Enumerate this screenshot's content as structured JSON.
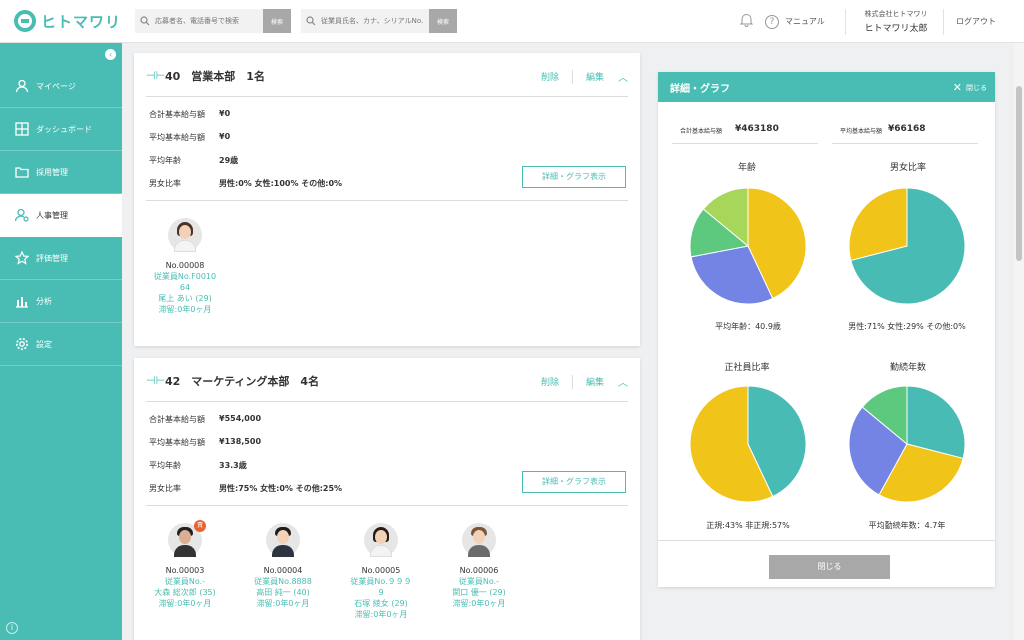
{
  "brand": {
    "name": "ヒトマワリ"
  },
  "header": {
    "search1": {
      "placeholder": "応募者名、電話番号で検索",
      "button": "検索"
    },
    "search2": {
      "placeholder": "従業員氏名、カナ、シリアルNo.",
      "button": "検索"
    },
    "manual_label": "マニュアル",
    "company": "株式会社ヒトマワリ",
    "user": "ヒトマワリ太郎",
    "logout_label": "ログアウト"
  },
  "sidebar": {
    "collapse_icon": "chevron-left-icon",
    "items": [
      {
        "label": "マイページ",
        "icon": "user-icon"
      },
      {
        "label": "ダッシュボード",
        "icon": "dashboard-icon"
      },
      {
        "label": "採用管理",
        "icon": "folder-icon"
      },
      {
        "label": "人事管理",
        "icon": "person-settings-icon",
        "active": true
      },
      {
        "label": "評価管理",
        "icon": "star-icon"
      },
      {
        "label": "分析",
        "icon": "bar-chart-icon"
      },
      {
        "label": "設定",
        "icon": "gear-icon"
      }
    ]
  },
  "departments": [
    {
      "title": "40　営業本部　1名",
      "delete_label": "削除",
      "edit_label": "編集",
      "stats": {
        "total_salary": {
          "label": "合計基本給与額",
          "value": "¥0"
        },
        "avg_salary": {
          "label": "平均基本給与額",
          "value": "¥0"
        },
        "avg_age": {
          "label": "平均年齢",
          "value": "29歳"
        },
        "gender_ratio": {
          "label": "男女比率",
          "value": "男性:0% 女性:100% その他:0%"
        }
      },
      "detail_button": "詳細・グラフ表示",
      "employees": [
        {
          "no": "No.00008",
          "emp_no_1": "従業員No.F0010",
          "emp_no_2": "64",
          "name": "尾上 あい (29)",
          "stay": "滞留:0年0ヶ月"
        }
      ]
    },
    {
      "title": "42　マーケティング本部　4名",
      "delete_label": "削除",
      "edit_label": "編集",
      "stats": {
        "total_salary": {
          "label": "合計基本給与額",
          "value": "¥554,000"
        },
        "avg_salary": {
          "label": "平均基本給与額",
          "value": "¥138,500"
        },
        "avg_age": {
          "label": "平均年齢",
          "value": "33.3歳"
        },
        "gender_ratio": {
          "label": "男女比率",
          "value": "男性:75% 女性:0% その他:25%"
        }
      },
      "detail_button": "詳細・グラフ表示",
      "employees": [
        {
          "no": "No.00003",
          "emp_no_1": "従業員No.-",
          "name": "大森 総次郎 (35)",
          "stay": "滞留:0年0ヶ月",
          "badge": "責"
        },
        {
          "no": "No.00004",
          "emp_no_1": "従業員No.8888",
          "name": "高田 純一 (40)",
          "stay": "滞留:0年0ヶ月"
        },
        {
          "no": "No.00005",
          "emp_no_1": "従業員No.９９９",
          "emp_no_2": "9",
          "name": "石塚 綾女 (29)",
          "stay": "滞留:0年0ヶ月"
        },
        {
          "no": "No.00006",
          "emp_no_1": "従業員No.-",
          "name": "関口 優一 (29)",
          "stay": "滞留:0年0ヶ月"
        }
      ]
    }
  ],
  "panel": {
    "title": "詳細・グラフ",
    "close_label": "閉じる",
    "total_salary": {
      "label": "合計基本給与額",
      "value": "¥463180"
    },
    "avg_salary": {
      "label": "平均基本給与額",
      "value": "¥66168"
    },
    "bottom_button": "閉じる"
  },
  "chart_data": [
    {
      "type": "pie",
      "title": "年齢",
      "caption": "平均年齢：40.9歳",
      "slices": [
        {
          "value": 43,
          "color": "#f0c419"
        },
        {
          "value": 29,
          "color": "#7484e4"
        },
        {
          "value": 14,
          "color": "#5cc97e"
        },
        {
          "value": 14,
          "color": "#a6d65a"
        }
      ]
    },
    {
      "type": "pie",
      "title": "男女比率",
      "caption": "男性:71% 女性:29% その他:0%",
      "slices": [
        {
          "value": 71,
          "color": "#48bcb4"
        },
        {
          "value": 29,
          "color": "#f0c419"
        }
      ]
    },
    {
      "type": "pie",
      "title": "正社員比率",
      "caption": "正規:43% 非正規:57%",
      "slices": [
        {
          "value": 43,
          "color": "#48bcb4"
        },
        {
          "value": 57,
          "color": "#f0c419"
        }
      ]
    },
    {
      "type": "pie",
      "title": "勤続年数",
      "caption": "平均勤続年数：4.7年",
      "slices": [
        {
          "value": 29,
          "color": "#48bcb4"
        },
        {
          "value": 29,
          "color": "#f0c419"
        },
        {
          "value": 28,
          "color": "#7484e4"
        },
        {
          "value": 14,
          "color": "#5cc97e"
        }
      ]
    }
  ]
}
